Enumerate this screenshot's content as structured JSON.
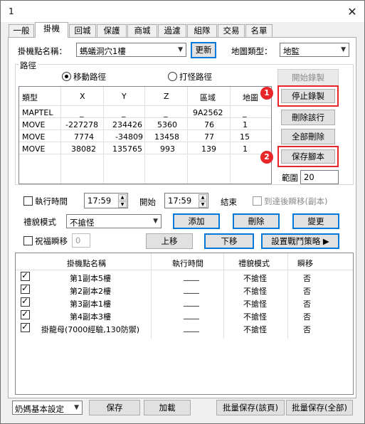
{
  "window": {
    "title": "1"
  },
  "tabs": [
    "一般",
    "掛機",
    "回城",
    "保護",
    "商城",
    "過濾",
    "組隊",
    "交易",
    "名單"
  ],
  "top": {
    "spot_label": "掛機點名稱：",
    "spot_value": "螞蟻洞穴1樓",
    "update_button": "更新",
    "map_type_label": "地圖類型：",
    "map_type_value": "地監"
  },
  "path": {
    "group_label": "路徑",
    "radio_move": "移動路徑",
    "radio_fight": "打怪路徑",
    "start_record": "開始錄製",
    "stop_record": "停止錄製",
    "delete_row": "刪除該行",
    "delete_all": "全部刪除",
    "save_script": "保存腳本",
    "range_label": "範圍",
    "range_value": "20",
    "badge1": "1",
    "badge2": "2",
    "columns": [
      "類型",
      "X",
      "Y",
      "Z",
      "區域",
      "地圖"
    ],
    "rows": [
      [
        "MAPTEL",
        "_",
        "_",
        "_",
        "9A2562",
        "_"
      ],
      [
        "MOVE",
        "-227278",
        "234426",
        "5360",
        "76",
        "1"
      ],
      [
        "MOVE",
        "7774",
        "-34809",
        "13458",
        "77",
        "15"
      ],
      [
        "MOVE",
        "38082",
        "135765",
        "993",
        "139",
        "1"
      ]
    ]
  },
  "schedule": {
    "exec_time_label": "執行時間",
    "time_start": "17:59",
    "start_label": "開始",
    "time_end": "17:59",
    "end_label": "結束",
    "teleport_label": "到達後瞬移(副本)",
    "mode_label": "禮貌模式",
    "mode_value": "不搶怪",
    "add": "添加",
    "delete": "刪除",
    "change": "變更",
    "bless_label": "祝福瞬移",
    "bless_value": "0",
    "move_up": "上移",
    "move_down": "下移",
    "set_strategy": "設置戰鬥策略 ▶"
  },
  "list": {
    "columns": [
      "掛機點名稱",
      "執行時間",
      "禮貌模式",
      "瞬移"
    ],
    "rows": [
      {
        "name": "第1副本5樓",
        "time": "____",
        "mode": "不搶怪",
        "tele": "否"
      },
      {
        "name": "第2副本2樓",
        "time": "____",
        "mode": "不搶怪",
        "tele": "否"
      },
      {
        "name": "第3副本1樓",
        "time": "____",
        "mode": "不搶怪",
        "tele": "否"
      },
      {
        "name": "第4副本3樓",
        "time": "____",
        "mode": "不搶怪",
        "tele": "否"
      },
      {
        "name": "掛龍母(7000經驗,130防禦)",
        "time": "____",
        "mode": "不搶怪",
        "tele": "否"
      }
    ]
  },
  "bottom": {
    "preset_value": "奶媽基本設定",
    "save": "保存",
    "load": "加載",
    "batch_save_current": "批量保存(該頁)",
    "batch_save_all": "批量保存(全部)"
  },
  "colors": {
    "highlight": "#e8262a",
    "focus_border": "#0078d7"
  }
}
